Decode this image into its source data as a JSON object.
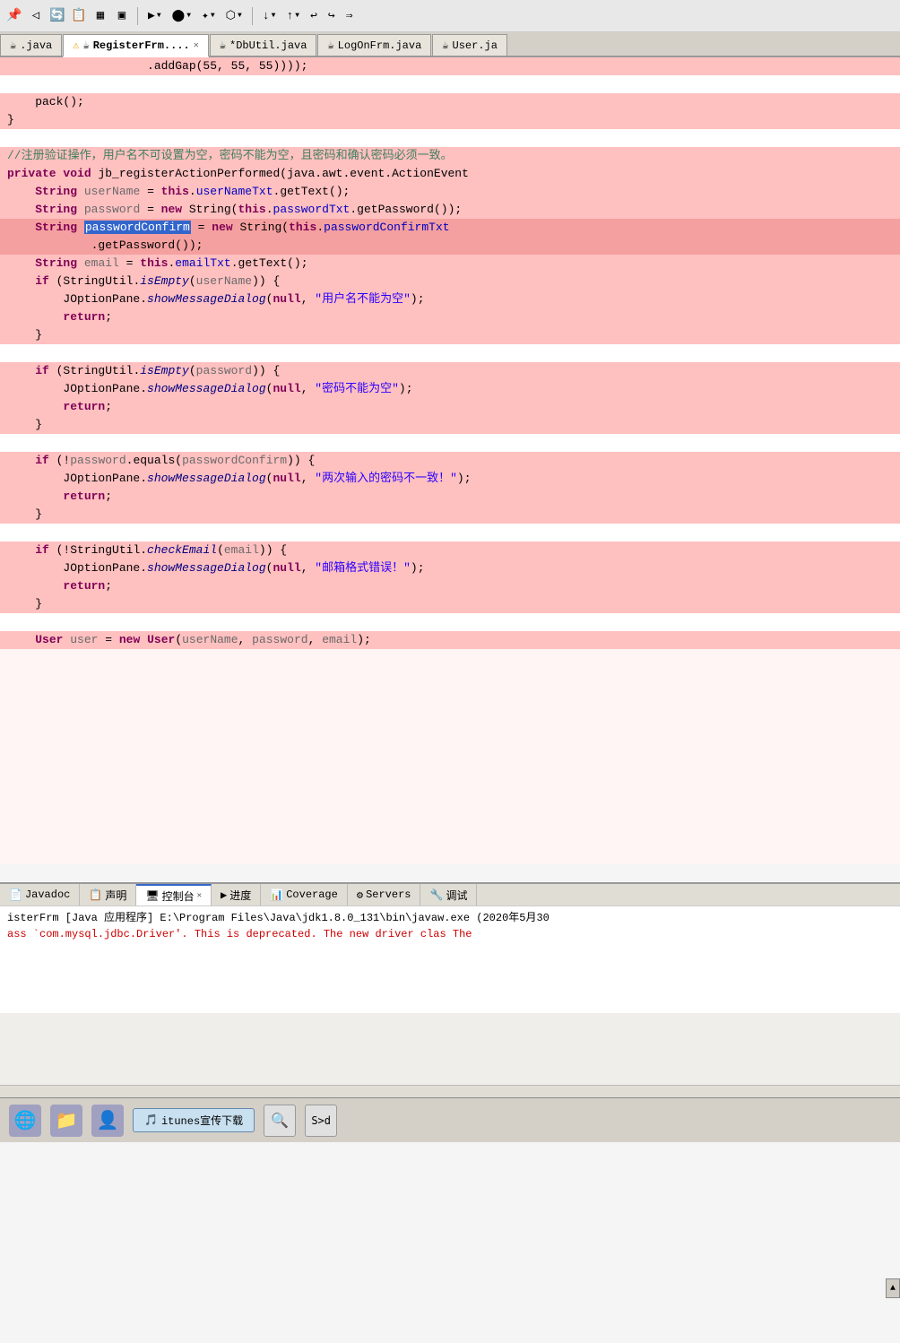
{
  "toolbar": {
    "icons": [
      "◎",
      "◁",
      "⊕",
      "▦",
      "▣",
      "❖",
      "▶",
      "▼",
      "⬤",
      "▼",
      "✦",
      "▼",
      "⬡",
      "▼",
      "⬟",
      "▼",
      "↓",
      "▼",
      "↑",
      "▼",
      "↩",
      "↪",
      "⇒"
    ]
  },
  "tabs": [
    {
      "id": "java1",
      "icon": "☕",
      "label": ".java",
      "active": false,
      "close": false,
      "warning": false
    },
    {
      "id": "registerfrm",
      "icon": "☕",
      "label": "RegisterFrm....",
      "active": true,
      "close": true,
      "warning": true
    },
    {
      "id": "dbutil",
      "icon": "☕",
      "label": "*DbUtil.java",
      "active": false,
      "close": false,
      "warning": false
    },
    {
      "id": "logonfrm",
      "icon": "☕",
      "label": "LogOnFrm.java",
      "active": false,
      "close": false,
      "warning": false
    },
    {
      "id": "user",
      "icon": "☕",
      "label": "User.ja",
      "active": false,
      "close": false,
      "warning": false
    }
  ],
  "code": {
    "lines": [
      {
        "type": "highlight",
        "content": "                    .addGap(55, 55, 55))));"
      },
      {
        "type": "normal",
        "content": ""
      },
      {
        "type": "highlight",
        "content": "    pack();"
      },
      {
        "type": "highlight",
        "content": "}"
      },
      {
        "type": "normal",
        "content": ""
      },
      {
        "type": "highlight",
        "content": "//注册验证操作，用户名不可设置为空，密码不能为空，且密码和确认密码必须一致。"
      },
      {
        "type": "highlight",
        "content": "private void jb_registerActionPerformed(java.awt.event.ActionEvent"
      },
      {
        "type": "highlight",
        "content": "    String userName = this.userNameTxt.getText();"
      },
      {
        "type": "highlight",
        "content": "    String password = new String(this.passwordTxt.getPassword());"
      },
      {
        "type": "dark-highlight",
        "content": "    String passwordConfirm = new String(this.passwordConfirmTxt"
      },
      {
        "type": "dark-highlight",
        "content": "            .getPassword());"
      },
      {
        "type": "highlight",
        "content": "    String email = this.emailTxt.getText();"
      },
      {
        "type": "highlight",
        "content": "    if (StringUtil.isEmpty(userName)) {"
      },
      {
        "type": "highlight",
        "content": "        JOptionPane.showMessageDialog(null, \"用户名不能为空\");"
      },
      {
        "type": "highlight",
        "content": "        return;"
      },
      {
        "type": "highlight",
        "content": "    }"
      },
      {
        "type": "normal",
        "content": ""
      },
      {
        "type": "highlight",
        "content": "    if (StringUtil.isEmpty(password)) {"
      },
      {
        "type": "highlight",
        "content": "        JOptionPane.showMessageDialog(null, \"密码不能为空\");"
      },
      {
        "type": "highlight",
        "content": "        return;"
      },
      {
        "type": "highlight",
        "content": "    }"
      },
      {
        "type": "normal",
        "content": ""
      },
      {
        "type": "highlight",
        "content": "    if (!password.equals(passwordConfirm)) {"
      },
      {
        "type": "highlight",
        "content": "        JOptionPane.showMessageDialog(null, \"两次输入的密码不一致！\");"
      },
      {
        "type": "highlight",
        "content": "        return;"
      },
      {
        "type": "highlight",
        "content": "    }"
      },
      {
        "type": "normal",
        "content": ""
      },
      {
        "type": "highlight",
        "content": "    if (!StringUtil.checkEmail(email)) {"
      },
      {
        "type": "highlight",
        "content": "        JOptionPane.showMessageDialog(null, \"邮箱格式错误！\");"
      },
      {
        "type": "highlight",
        "content": "        return;"
      },
      {
        "type": "highlight",
        "content": "    }"
      },
      {
        "type": "normal",
        "content": ""
      },
      {
        "type": "highlight",
        "content": "    User user = new User(userName, password, email);"
      }
    ]
  },
  "bottom_tabs": [
    {
      "id": "javadoc",
      "label": "Javadoc",
      "icon": "📄",
      "active": false,
      "close": false
    },
    {
      "id": "declaration",
      "label": "声明",
      "icon": "📋",
      "active": false,
      "close": false
    },
    {
      "id": "console",
      "label": "控制台",
      "icon": "🖥",
      "active": true,
      "close": true
    },
    {
      "id": "progress",
      "label": "进度",
      "icon": "▶",
      "active": false,
      "close": false
    },
    {
      "id": "coverage",
      "label": "Coverage",
      "icon": "📊",
      "active": false,
      "close": false
    },
    {
      "id": "servers",
      "label": "Servers",
      "icon": "⚙",
      "active": false,
      "close": false
    },
    {
      "id": "debug",
      "label": "调试",
      "icon": "🔧",
      "active": false,
      "close": false
    }
  ],
  "console": {
    "line1": "isterFrm [Java 应用程序] E:\\Program Files\\Java\\jdk1.8.0_131\\bin\\javaw.exe  (2020年5月30",
    "line2": "ass `com.mysql.jdbc.Driver'. This is deprecated. The new driver clas"
  },
  "os_bar": {
    "taskbar_label": "itunes宣传下载",
    "search_placeholder": "搜索"
  }
}
